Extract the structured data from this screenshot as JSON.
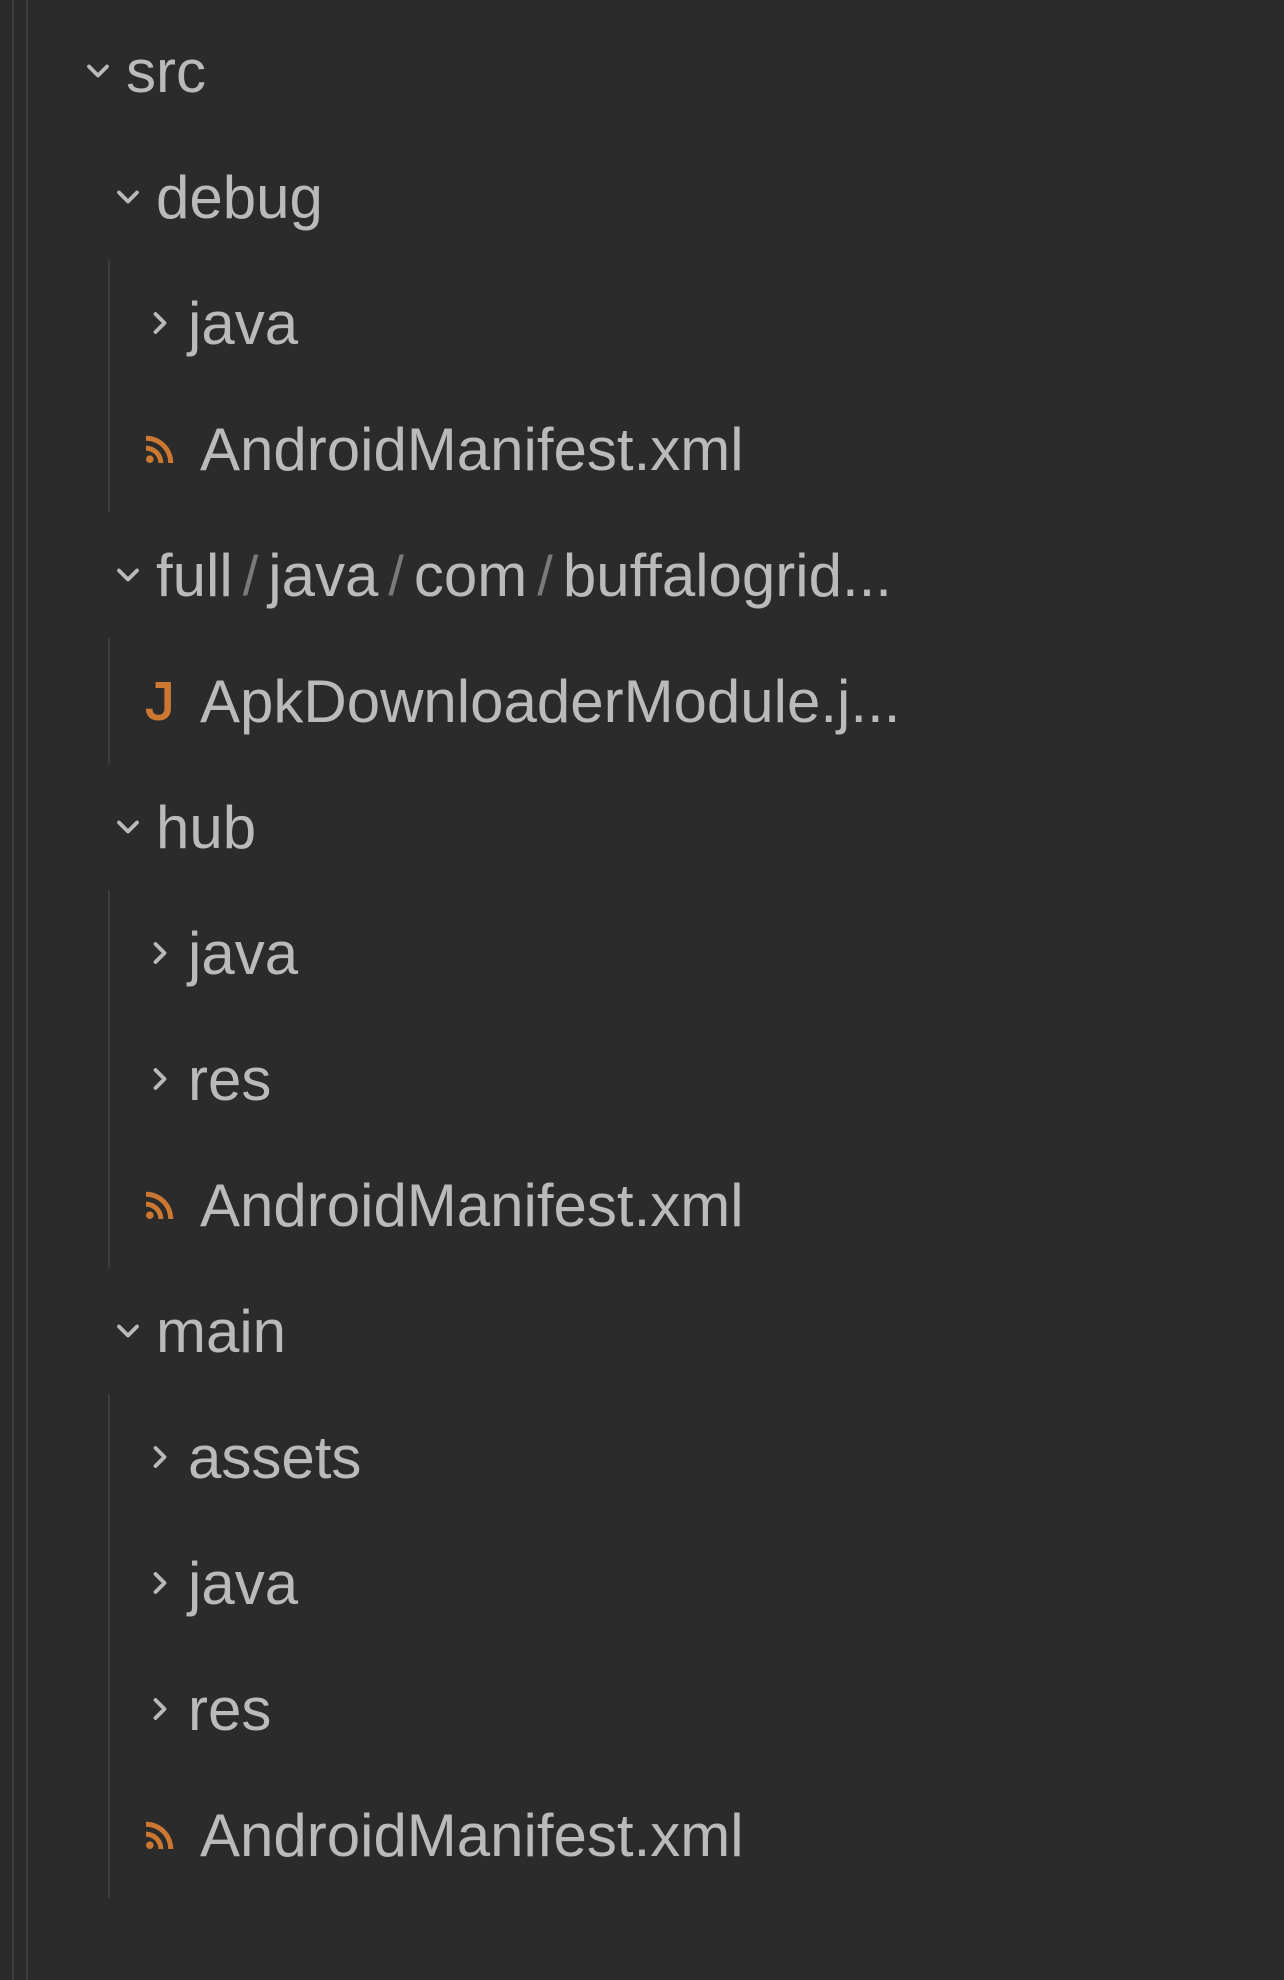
{
  "tree": {
    "src": {
      "label": "src",
      "debug": {
        "label": "debug",
        "java": "java",
        "manifest": "AndroidManifest.xml"
      },
      "full": {
        "segments": [
          "full",
          "java",
          "com",
          "buffalogrid..."
        ],
        "apk_file": "ApkDownloaderModule.j..."
      },
      "hub": {
        "label": "hub",
        "java": "java",
        "res": "res",
        "manifest": "AndroidManifest.xml"
      },
      "main": {
        "label": "main",
        "assets": "assets",
        "java": "java",
        "res": "res",
        "manifest": "AndroidManifest.xml"
      }
    }
  },
  "icons": {
    "java_letter": "J"
  }
}
